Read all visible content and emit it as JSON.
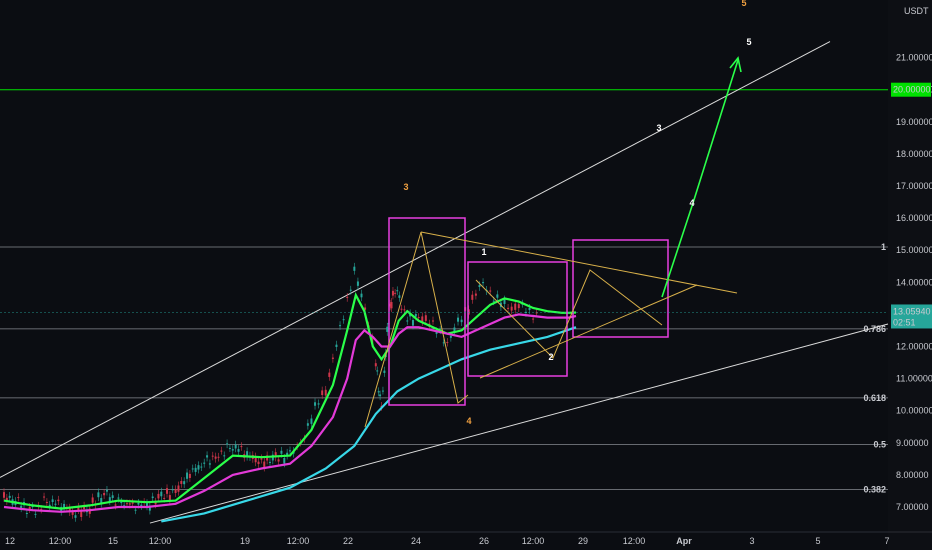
{
  "chart_data": {
    "type": "candlestick",
    "currency_label": "USDT",
    "y_ticks": [
      "7.00000",
      "8.00000",
      "9.00000",
      "10.00000",
      "11.00000",
      "12.00000",
      "13.00000",
      "14.00000",
      "15.00000",
      "16.00000",
      "17.00000",
      "18.00000",
      "19.00000",
      "20.00000",
      "21.00000"
    ],
    "x_ticks": [
      "12",
      "12:00",
      "15",
      "12:00",
      "19",
      "12:00",
      "22",
      "24",
      "26",
      "12:00",
      "29",
      "12:00",
      "Apr",
      "3",
      "5",
      "7"
    ],
    "current_price": {
      "value": "13.05940",
      "countdown": "02:51",
      "color": "#26a69a"
    },
    "target_price": {
      "value": "20.00000",
      "color": "#00e000"
    },
    "fib_levels": [
      {
        "label": "1",
        "value": 15.1
      },
      {
        "label": "0.786",
        "value": 12.55
      },
      {
        "label": "0.618",
        "value": 10.4
      },
      {
        "label": "0.5",
        "value": 8.95
      },
      {
        "label": "0.382",
        "value": 7.55
      }
    ],
    "wave_labels": [
      {
        "text": "3",
        "color": "#f0a040"
      },
      {
        "text": "4",
        "color": "#f0a040"
      },
      {
        "text": "5",
        "color": "#f0a040"
      },
      {
        "text": "1",
        "color": "#ffffff"
      },
      {
        "text": "2",
        "color": "#ffffff"
      },
      {
        "text": "3",
        "color": "#ffffff"
      },
      {
        "text": "4",
        "color": "#ffffff"
      },
      {
        "text": "5",
        "color": "#ffffff"
      }
    ],
    "price_series": {
      "x": [
        0,
        10,
        20,
        30,
        40,
        50,
        60,
        70,
        80,
        90,
        100,
        110,
        120,
        130,
        140,
        150,
        160,
        170,
        180,
        190,
        200,
        205,
        210,
        215,
        220,
        225,
        230,
        235,
        240,
        245,
        250,
        255,
        260,
        262,
        264,
        266,
        268,
        270,
        272,
        275,
        278,
        282,
        286,
        290,
        295,
        300,
        305,
        310,
        315,
        320,
        325,
        330,
        335,
        340,
        345,
        350,
        355,
        360,
        365,
        370,
        375,
        380,
        385,
        390,
        395,
        400,
        405,
        410,
        415,
        420,
        425,
        430,
        435,
        440,
        445,
        450
      ],
      "close": [
        7.3,
        7.1,
        6.9,
        7.2,
        7.0,
        6.8,
        7.0,
        7.4,
        7.2,
        7.1,
        7.0,
        7.3,
        7.5,
        8.0,
        8.4,
        8.7,
        8.9,
        8.6,
        8.4,
        8.5,
        8.6,
        8.9,
        9.3,
        9.8,
        10.3,
        10.6,
        11.5,
        12.5,
        13.5,
        14.4,
        13.6,
        12.7,
        11.5,
        10.6,
        10.2,
        11.2,
        12.4,
        13.2,
        13.6,
        13.7,
        13.3,
        13.0,
        12.8,
        12.9,
        12.8,
        12.6,
        12.4,
        12.2,
        12.6,
        12.9,
        13.2,
        13.6,
        13.9,
        13.7,
        13.5,
        13.3,
        13.2,
        13.3,
        13.1,
        13.0,
        13.1,
        13.05,
        13.06,
        13.06,
        13.06,
        13.06,
        13.06,
        13.06,
        13.06,
        13.06,
        13.06,
        13.06,
        13.06,
        13.06,
        13.06,
        13.06
      ]
    },
    "ma_series": [
      {
        "color": "#2aff4a",
        "x": [
          0,
          20,
          40,
          60,
          80,
          100,
          120,
          140,
          160,
          180,
          200,
          215,
          230,
          240,
          246,
          252,
          258,
          264,
          270,
          276,
          282,
          290,
          300,
          310,
          320,
          330,
          340,
          350,
          360,
          370,
          380,
          390,
          395,
          400
        ],
        "y": [
          7.2,
          7.05,
          6.95,
          7.05,
          7.2,
          7.15,
          7.2,
          7.9,
          8.6,
          8.55,
          8.6,
          9.4,
          10.8,
          12.5,
          13.6,
          13.1,
          12.0,
          11.6,
          12.0,
          12.8,
          13.1,
          12.8,
          12.6,
          12.4,
          12.5,
          12.9,
          13.3,
          13.5,
          13.4,
          13.2,
          13.1,
          13.05,
          13.05,
          13.06
        ]
      },
      {
        "color": "#e33ad8",
        "x": [
          0,
          20,
          40,
          60,
          80,
          100,
          120,
          140,
          160,
          180,
          200,
          215,
          230,
          240,
          246,
          252,
          258,
          264,
          270,
          276,
          282,
          290,
          300,
          310,
          320,
          330,
          340,
          350,
          360,
          370,
          380,
          390,
          395,
          400
        ],
        "y": [
          7.0,
          6.9,
          6.85,
          6.9,
          7.0,
          7.0,
          7.1,
          7.5,
          8.0,
          8.2,
          8.35,
          8.9,
          9.8,
          11.0,
          12.2,
          12.5,
          12.3,
          12.0,
          12.0,
          12.4,
          12.6,
          12.6,
          12.5,
          12.4,
          12.3,
          12.5,
          12.7,
          12.9,
          13.0,
          12.95,
          12.9,
          12.9,
          12.9,
          12.95
        ]
      },
      {
        "color": "#38d8e8",
        "x": [
          110,
          140,
          170,
          200,
          225,
          245,
          260,
          275,
          290,
          305,
          320,
          340,
          360,
          380,
          400
        ],
        "y": [
          6.55,
          6.8,
          7.2,
          7.6,
          8.2,
          8.9,
          9.9,
          10.6,
          11.0,
          11.3,
          11.6,
          11.9,
          12.1,
          12.3,
          12.6
        ]
      }
    ]
  }
}
